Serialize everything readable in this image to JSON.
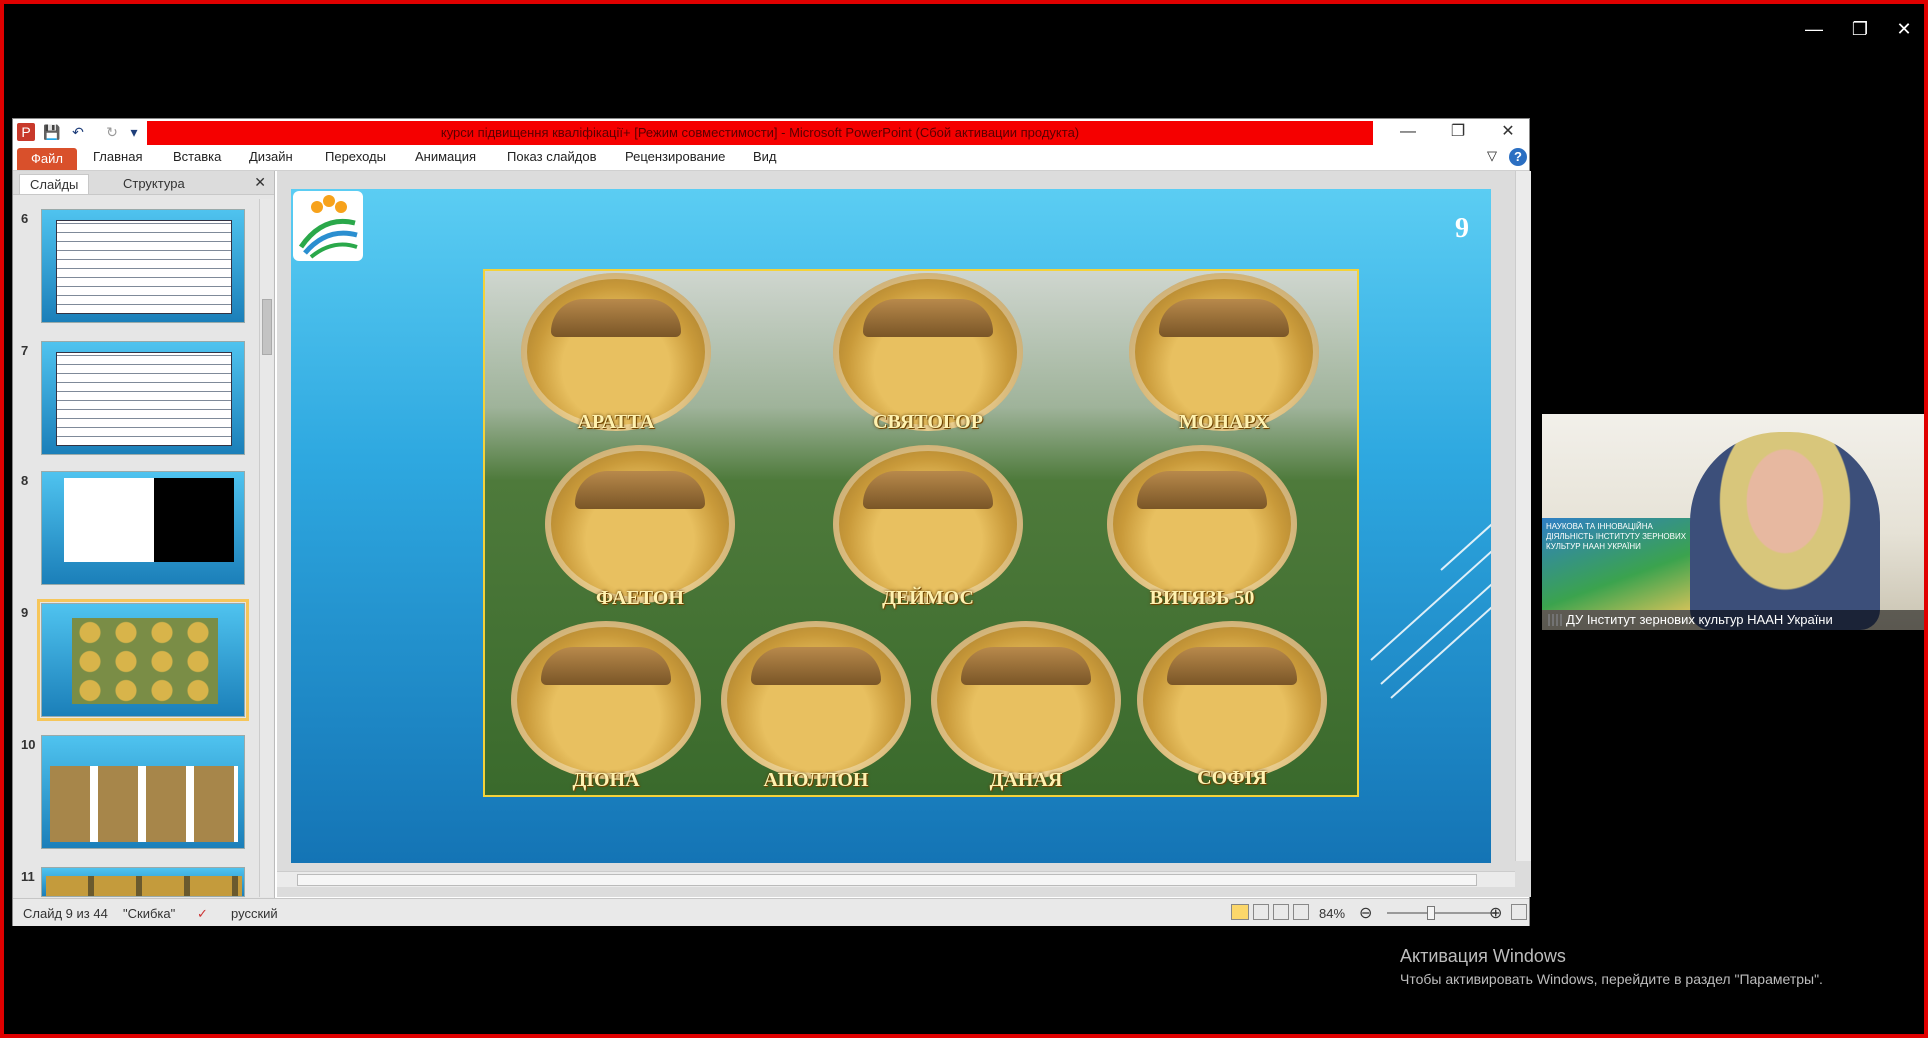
{
  "window_controls": {
    "minimize": "—",
    "restore": "❐",
    "close": "✕"
  },
  "ppt": {
    "title": "курси підвищення кваліфікації+ [Режим совместимости]  -  Microsoft PowerPoint (Сбой активации продукта)",
    "quick_access": {
      "app_icon": "P",
      "save": "💾",
      "undo": "↶",
      "redo": "↻",
      "customize": "▾"
    },
    "controls": {
      "minimize": "—",
      "restore": "❐",
      "close": "✕"
    },
    "ribbon": {
      "file": "Файл",
      "tabs": [
        "Главная",
        "Вставка",
        "Дизайн",
        "Переходы",
        "Анимация",
        "Показ слайдов",
        "Рецензирование",
        "Вид"
      ],
      "collapse": "▽",
      "help": "?"
    },
    "panel": {
      "tabs": [
        "Слайды",
        "Структура"
      ],
      "close": "✕",
      "thumbnails": [
        {
          "num": "6"
        },
        {
          "num": "7"
        },
        {
          "num": "8"
        },
        {
          "num": "9",
          "selected": true
        },
        {
          "num": "10"
        },
        {
          "num": "11"
        }
      ]
    },
    "slide": {
      "number": "9",
      "varieties": [
        "АРАТТА",
        "СВЯТОГОР",
        "МОНАРХ",
        "ФАЕТОН",
        "ДЕЙМОС",
        "ВИТЯЗЬ 50",
        "ДІОНА",
        "АПОЛЛОН",
        "ДАНАЯ",
        "СОФІЯ"
      ]
    },
    "status": {
      "slide_info": "Слайд 9 из 44",
      "theme": "\"Скибка\"",
      "language": "русский",
      "zoom": "84%",
      "zoom_out": "⊖",
      "zoom_in": "⊕"
    }
  },
  "webcam": {
    "label": "ДУ Інститут зернових культур НААН України",
    "wall_text": "НАУКОВА ТА ІННОВАЦІЙНА ДІЯЛЬНІСТЬ ІНСТИТУТУ ЗЕРНОВИХ КУЛЬТУР НААН УКРАЇНИ"
  },
  "activation": {
    "title": "Активация Windows",
    "subtitle": "Чтобы активировать Windows, перейдите в раздел \"Параметры\"."
  },
  "colors": {
    "frame_border": "#e00000",
    "title_bar": "#f50000",
    "file_tab": "#d9502b",
    "label_gold": "#f4d23a"
  }
}
